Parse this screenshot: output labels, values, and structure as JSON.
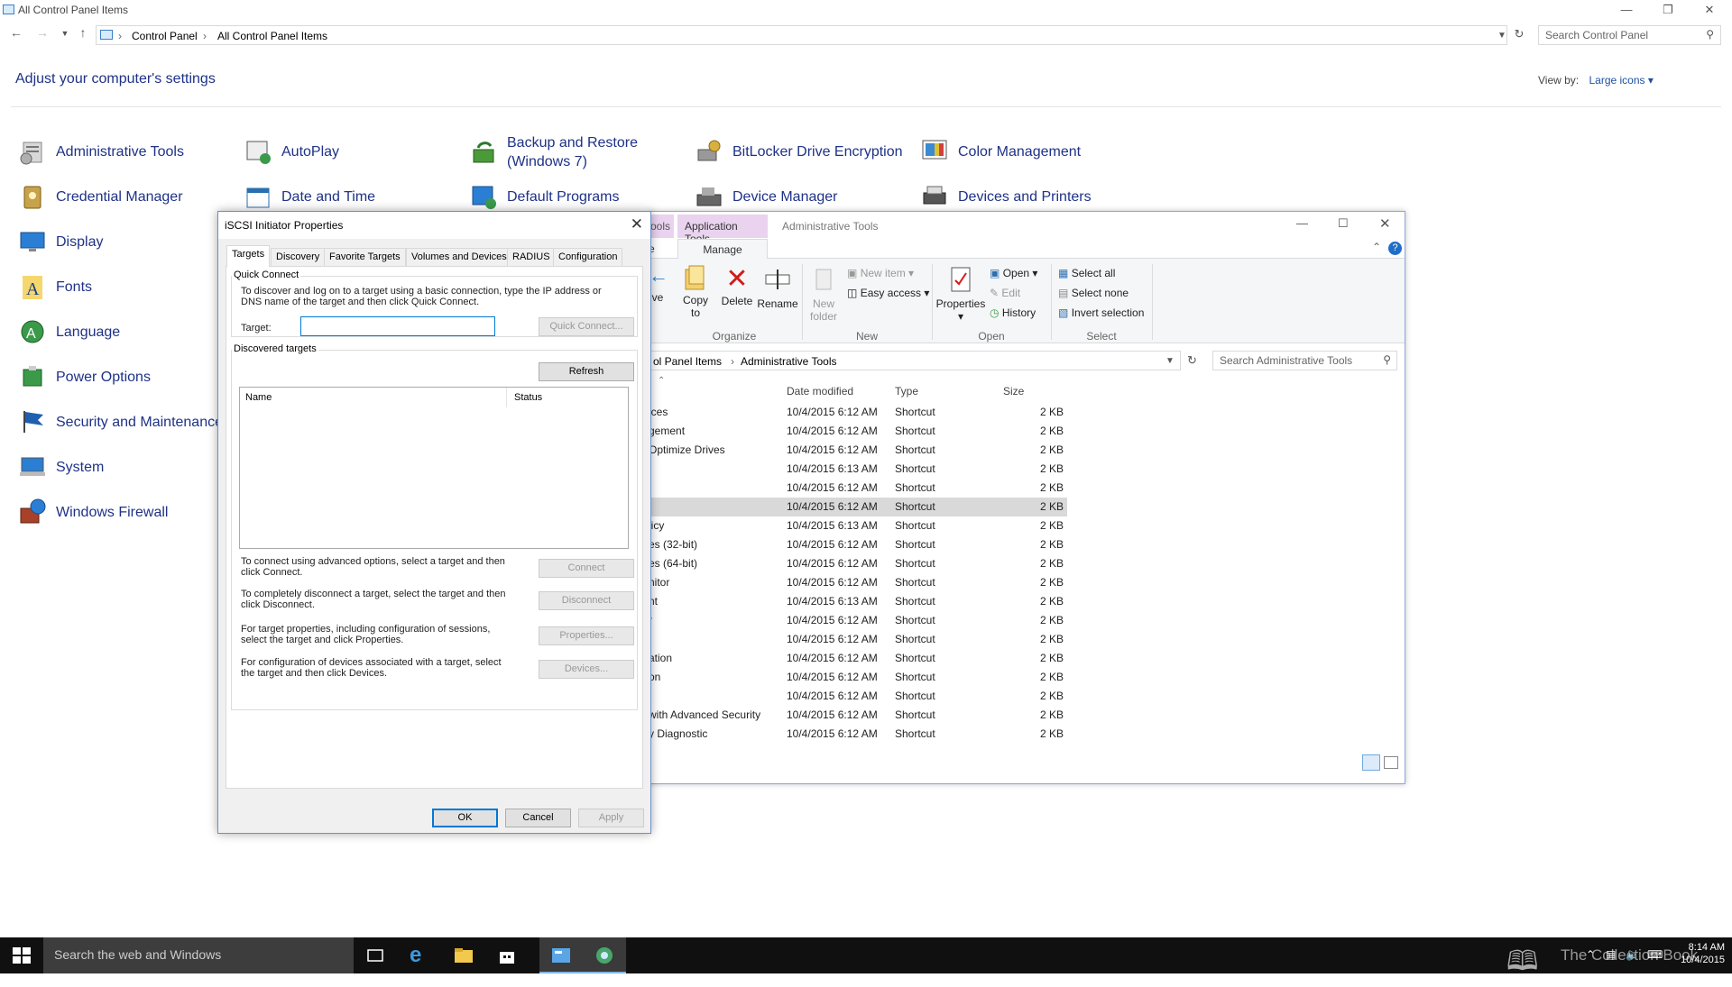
{
  "cp": {
    "window_title": "All Control Panel Items",
    "breadcrumb": [
      "Control Panel",
      "All Control Panel Items"
    ],
    "search_placeholder": "Search Control Panel",
    "heading": "Adjust your computer's settings",
    "view_by_label": "View by:",
    "view_by_value": "Large icons",
    "items": [
      {
        "label": "Administrative Tools",
        "icon": "admin-tools-icon"
      },
      {
        "label": "Credential Manager",
        "icon": "credential-manager-icon"
      },
      {
        "label": "Display",
        "icon": "display-icon"
      },
      {
        "label": "Fonts",
        "icon": "fonts-icon"
      },
      {
        "label": "Language",
        "icon": "language-icon"
      },
      {
        "label": "Power Options",
        "icon": "power-options-icon"
      },
      {
        "label": "Security and Maintenance",
        "icon": "security-flag-icon"
      },
      {
        "label": "System",
        "icon": "system-icon"
      },
      {
        "label": "Windows Firewall",
        "icon": "firewall-icon"
      },
      {
        "label": "AutoPlay",
        "icon": "autoplay-icon"
      },
      {
        "label": "Date and Time",
        "icon": "date-time-icon"
      },
      {
        "label": "Backup and Restore",
        "label2": "(Windows 7)",
        "icon": "backup-icon"
      },
      {
        "label": "Default Programs",
        "icon": "default-programs-icon"
      },
      {
        "label": "BitLocker Drive Encryption",
        "icon": "bitlocker-icon"
      },
      {
        "label": "Device Manager",
        "icon": "device-manager-icon"
      },
      {
        "label": "Color Management",
        "icon": "color-management-icon"
      },
      {
        "label": "Devices and Printers",
        "icon": "devices-printers-icon"
      }
    ]
  },
  "explorer": {
    "context_tab": "Application Tools",
    "context_tab_partial": "ools",
    "window_title": "Administrative Tools",
    "manage_tab": "Manage",
    "partial_tab": "e",
    "ribbon": {
      "move_partial": "ve",
      "copy": "Copy",
      "copy2": "to",
      "delete": "Delete",
      "rename": "Rename",
      "new_folder": "New",
      "new_folder2": "folder",
      "new_item": "New item",
      "easy_access": "Easy access",
      "properties": "Properties",
      "open": "Open",
      "edit": "Edit",
      "history": "History",
      "select_all": "Select all",
      "select_none": "Select none",
      "invert": "Invert selection",
      "groups": [
        "Organize",
        "New",
        "Open",
        "Select"
      ]
    },
    "address": [
      "ol Panel Items",
      "Administrative Tools"
    ],
    "search_placeholder": "Search Administrative Tools",
    "columns": [
      "Date modified",
      "Type",
      "Size"
    ],
    "rows": [
      {
        "name": "ices",
        "date": "10/4/2015 6:12 AM",
        "type": "Shortcut",
        "size": "2 KB"
      },
      {
        "name": "gement",
        "date": "10/4/2015 6:12 AM",
        "type": "Shortcut",
        "size": "2 KB"
      },
      {
        "name": "Optimize Drives",
        "date": "10/4/2015 6:12 AM",
        "type": "Shortcut",
        "size": "2 KB"
      },
      {
        "name": "",
        "date": "10/4/2015 6:13 AM",
        "type": "Shortcut",
        "size": "2 KB"
      },
      {
        "name": "",
        "date": "10/4/2015 6:12 AM",
        "type": "Shortcut",
        "size": "2 KB"
      },
      {
        "name": "",
        "date": "10/4/2015 6:12 AM",
        "type": "Shortcut",
        "size": "2 KB"
      },
      {
        "name": "licy",
        "date": "10/4/2015 6:13 AM",
        "type": "Shortcut",
        "size": "2 KB"
      },
      {
        "name": "es (32-bit)",
        "date": "10/4/2015 6:12 AM",
        "type": "Shortcut",
        "size": "2 KB"
      },
      {
        "name": "es (64-bit)",
        "date": "10/4/2015 6:12 AM",
        "type": "Shortcut",
        "size": "2 KB"
      },
      {
        "name": "nitor",
        "date": "10/4/2015 6:12 AM",
        "type": "Shortcut",
        "size": "2 KB"
      },
      {
        "name": "nt",
        "date": "10/4/2015 6:13 AM",
        "type": "Shortcut",
        "size": "2 KB"
      },
      {
        "name": "r",
        "date": "10/4/2015 6:12 AM",
        "type": "Shortcut",
        "size": "2 KB"
      },
      {
        "name": "",
        "date": "10/4/2015 6:12 AM",
        "type": "Shortcut",
        "size": "2 KB"
      },
      {
        "name": "ation",
        "date": "10/4/2015 6:12 AM",
        "type": "Shortcut",
        "size": "2 KB"
      },
      {
        "name": "on",
        "date": "10/4/2015 6:12 AM",
        "type": "Shortcut",
        "size": "2 KB"
      },
      {
        "name": "",
        "date": "10/4/2015 6:12 AM",
        "type": "Shortcut",
        "size": "2 KB"
      },
      {
        "name": "with Advanced Security",
        "date": "10/4/2015 6:12 AM",
        "type": "Shortcut",
        "size": "2 KB"
      },
      {
        "name": "y Diagnostic",
        "date": "10/4/2015 6:12 AM",
        "type": "Shortcut",
        "size": "2 KB"
      }
    ]
  },
  "dialog": {
    "title": "iSCSI Initiator Properties",
    "tabs": [
      "Targets",
      "Discovery",
      "Favorite Targets",
      "Volumes and Devices",
      "RADIUS",
      "Configuration"
    ],
    "quick_connect": "Quick Connect",
    "qc_desc": "To discover and log on to a target using a basic connection, type the IP address or DNS name of the target and then click Quick Connect.",
    "target_label": "Target:",
    "target_value": "",
    "quick_connect_btn": "Quick Connect...",
    "discovered": "Discovered targets",
    "refresh": "Refresh",
    "col_name": "Name",
    "col_status": "Status",
    "p1": "To connect using advanced options, select a target and then click Connect.",
    "b1": "Connect",
    "p2": "To completely disconnect a target, select the target and then click Disconnect.",
    "b2": "Disconnect",
    "p3": "For target properties, including configuration of sessions, select the target and click Properties.",
    "b3": "Properties...",
    "p4": "For configuration of devices associated with a target, select the target and then click Devices.",
    "b4": "Devices...",
    "ok": "OK",
    "cancel": "Cancel",
    "apply": "Apply"
  },
  "taskbar": {
    "search": "Search the web and Windows",
    "watermark": "The Collection Book",
    "time": "8:14 AM",
    "date": "10/4/2015"
  }
}
